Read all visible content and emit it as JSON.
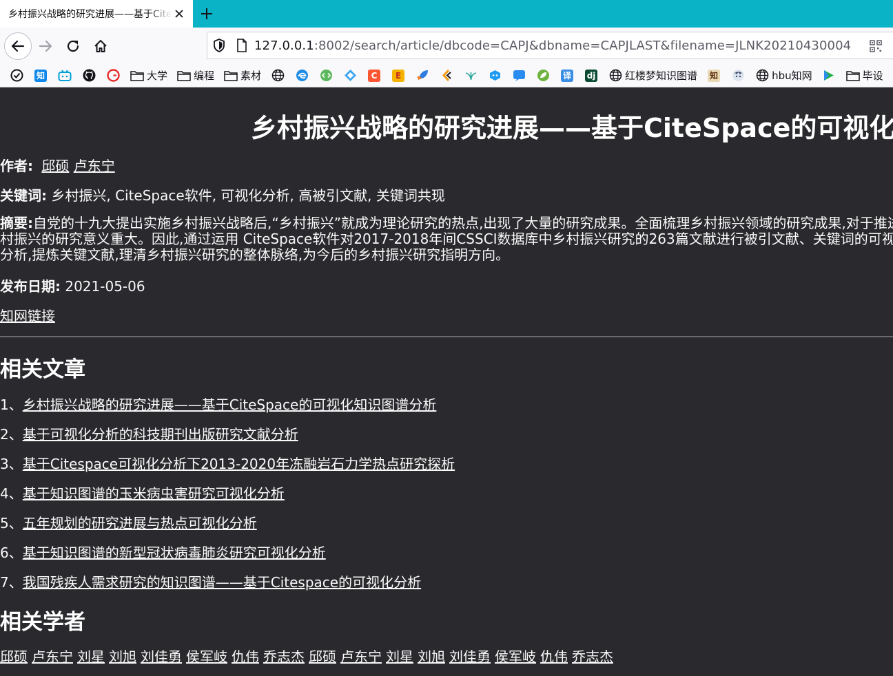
{
  "browser": {
    "tab_title": "乡村振兴战略的研究进展——基于CiteSpace的可视化知识图谱分析",
    "url_host": "127.0.0.1",
    "url_rest": ":8002/search/article/dbcode=CAPJ&dbname=CAPJLAST&filename=JLNK20210430004",
    "bookmarks": {
      "daxue": "大学",
      "biancheng": "编程",
      "sucai": "素材",
      "hongloumeng": "红楼梦知识图谱",
      "hbu": "hbu知网",
      "bishe": "毕设"
    },
    "colors": {
      "tabstrip": "#0bb3c7",
      "page_bg": "#2a2a2e"
    }
  },
  "article": {
    "title": "乡村振兴战略的研究进展——基于CiteSpace的可视化知识图谱分析",
    "authors_label": "作者:",
    "authors": [
      "邱硕",
      "卢东宁"
    ],
    "keywords_label": "关键词:",
    "keywords": "乡村振兴, CiteSpace软件, 可视化分析, 高被引文献, 关键词共现",
    "abstract_label": "摘要:",
    "abstract": "自党的十九大提出实施乡村振兴战略后,“乡村振兴”就成为理论研究的热点,出现了大量的研究成果。全面梳理乡村振兴领域的研究成果,对于推进乡村振兴的研究意义重大。因此,通过运用 CiteSpace软件对2017-2018年间CSSCI数据库中乡村振兴研究的263篇文献进行被引文献、关键词的可视化分析,提炼关键文献,理清乡村振兴研究的整体脉络,为今后的乡村振兴研究指明方向。",
    "date_label": "发布日期:",
    "date": "2021-05-06",
    "cnki_link": "知网链接"
  },
  "related_articles": {
    "heading": "相关文章",
    "items": [
      {
        "num": "1、",
        "title": "乡村振兴战略的研究进展——基于CiteSpace的可视化知识图谱分析"
      },
      {
        "num": "2、",
        "title": "基于可视化分析的科技期刊出版研究文献分析"
      },
      {
        "num": "3、",
        "title": "基于Citespace可视化分析下2013-2020年冻融岩石力学热点研究探析"
      },
      {
        "num": "4、",
        "title": "基于知识图谱的玉米病虫害研究可视化分析"
      },
      {
        "num": "5、",
        "title": "五年规划的研究进展与热点可视化分析"
      },
      {
        "num": "6、",
        "title": "基于知识图谱的新型冠状病毒肺炎研究可视化分析"
      },
      {
        "num": "7、",
        "title": "我国残疾人需求研究的知识图谱——基于Citespace的可视化分析"
      }
    ]
  },
  "related_scholars": {
    "heading": "相关学者",
    "names": [
      "邱硕",
      "卢东宁",
      "刘星",
      "刘旭",
      "刘佳勇",
      "侯军岐",
      "仇伟",
      "乔志杰",
      "邱硕",
      "卢东宁",
      "刘星",
      "刘旭",
      "刘佳勇",
      "侯军岐",
      "仇伟",
      "乔志杰"
    ]
  }
}
